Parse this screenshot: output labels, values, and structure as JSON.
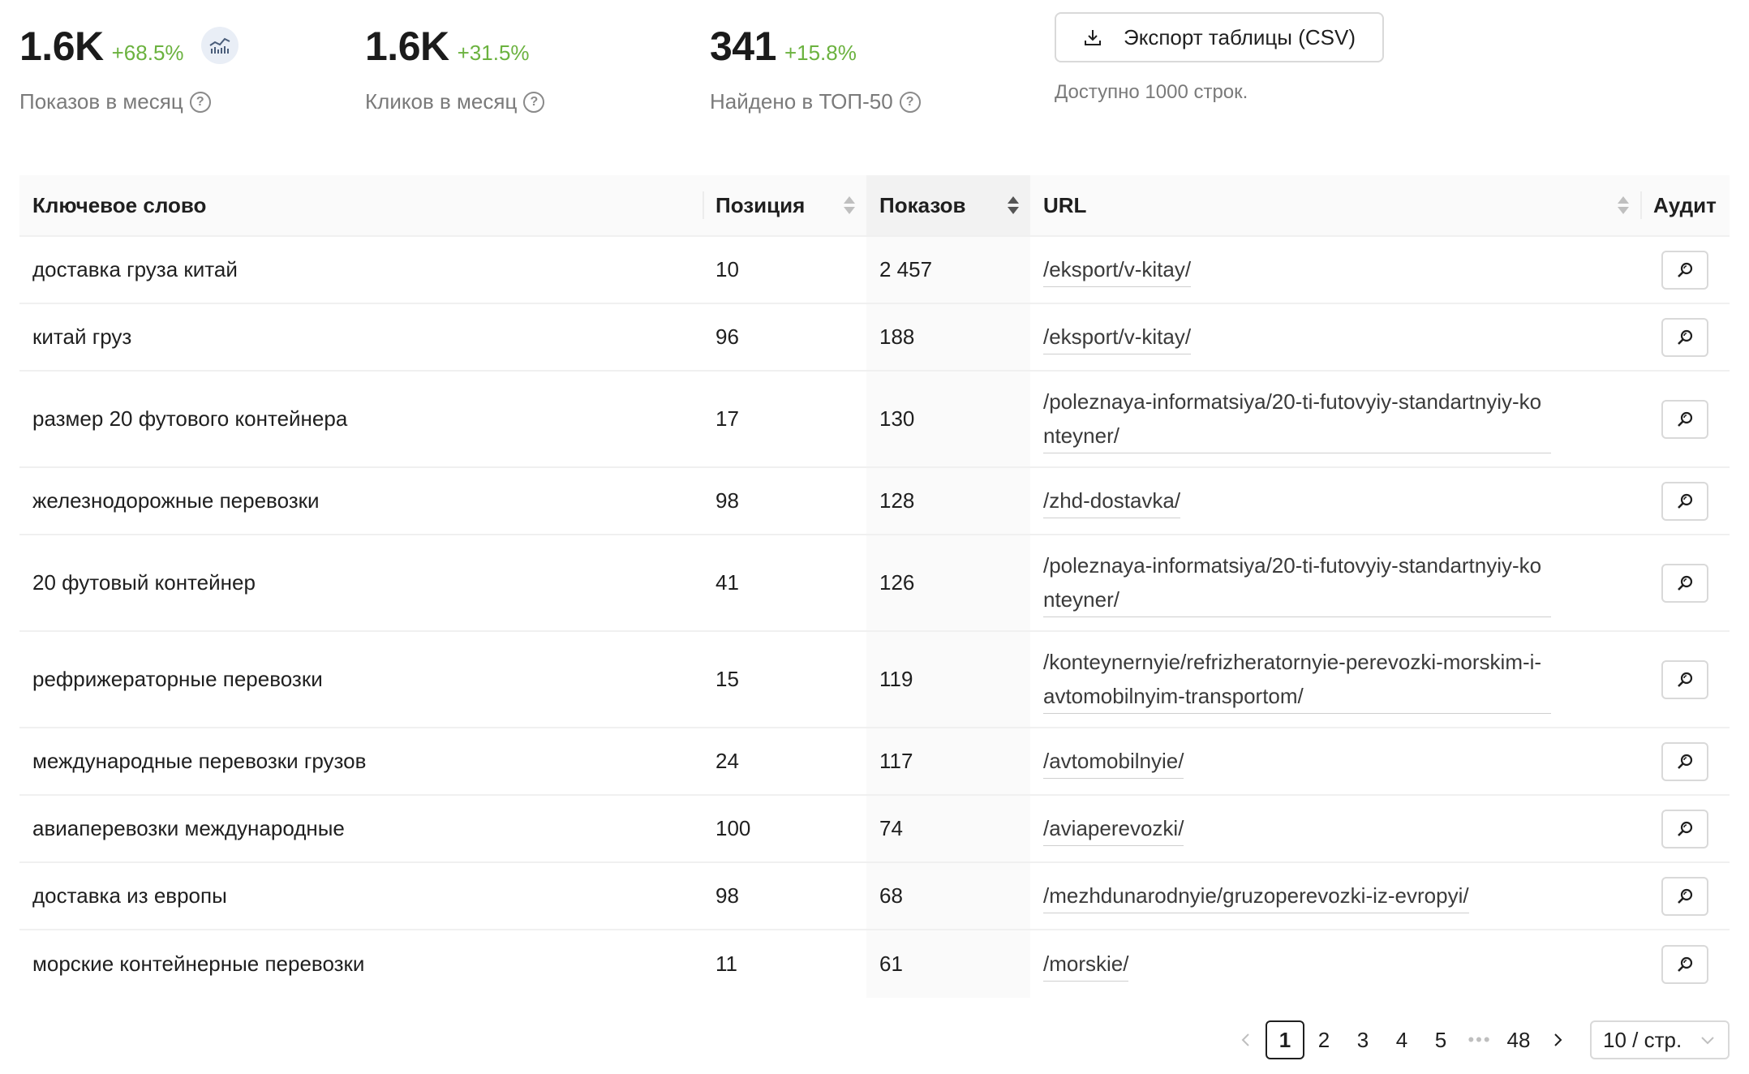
{
  "stats": [
    {
      "value": "1.6K",
      "delta": "+68.5%",
      "label": "Показов в месяц"
    },
    {
      "value": "1.6K",
      "delta": "+31.5%",
      "label": "Кликов в месяц"
    },
    {
      "value": "341",
      "delta": "+15.8%",
      "label": "Найдено в ТОП-50"
    }
  ],
  "export": {
    "label": "Экспорт таблицы (CSV)",
    "note": "Доступно 1000 строк."
  },
  "table": {
    "headers": {
      "keyword": "Ключевое слово",
      "position": "Позиция",
      "impressions": "Показов",
      "url": "URL",
      "audit": "Аудит"
    },
    "rows": [
      {
        "keyword": "доставка груза китай",
        "position": "10",
        "impressions": "2 457",
        "url": "/eksport/v-kitay/"
      },
      {
        "keyword": "китай груз",
        "position": "96",
        "impressions": "188",
        "url": "/eksport/v-kitay/"
      },
      {
        "keyword": "размер 20 футового контейнера",
        "position": "17",
        "impressions": "130",
        "url": "/poleznaya-informatsiya/20-ti-futovyiy-standartnyiy-konteyner/"
      },
      {
        "keyword": "железнодорожные перевозки",
        "position": "98",
        "impressions": "128",
        "url": "/zhd-dostavka/"
      },
      {
        "keyword": "20 футовый контейнер",
        "position": "41",
        "impressions": "126",
        "url": "/poleznaya-informatsiya/20-ti-futovyiy-standartnyiy-konteyner/"
      },
      {
        "keyword": "рефрижераторные перевозки",
        "position": "15",
        "impressions": "119",
        "url": "/konteynernyie/refrizheratornyie-perevozki-morskim-i-avtomobilnyim-transportom/"
      },
      {
        "keyword": "международные перевозки грузов",
        "position": "24",
        "impressions": "117",
        "url": "/avtomobilnyie/"
      },
      {
        "keyword": "авиаперевозки международные",
        "position": "100",
        "impressions": "74",
        "url": "/aviaperevozki/"
      },
      {
        "keyword": "доставка из европы",
        "position": "98",
        "impressions": "68",
        "url": "/mezhdunarodnyie/gruzoperevozki-iz-evropyi/"
      },
      {
        "keyword": "морские контейнерные перевозки",
        "position": "11",
        "impressions": "61",
        "url": "/morskie/"
      }
    ]
  },
  "pagination": {
    "pages": [
      "1",
      "2",
      "3",
      "4",
      "5"
    ],
    "current": "1",
    "last": "48",
    "page_size": "10 / стр."
  },
  "icons": {
    "chart": "bar-chart-icon",
    "download": "download-icon",
    "help": "question-circle-icon",
    "audit": "zoom-icon"
  },
  "colors": {
    "delta_positive": "#6bb23f",
    "accent_bg": "#e9eef6"
  }
}
